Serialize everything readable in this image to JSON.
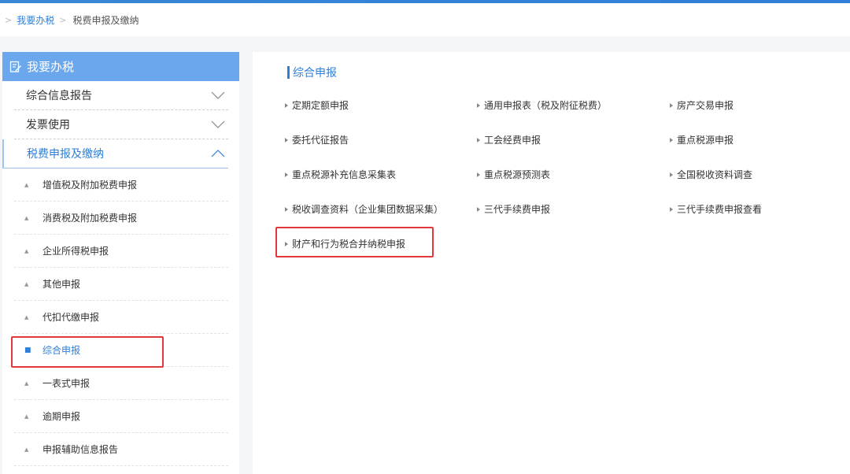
{
  "breadcrumb": {
    "root": "我要办税",
    "current": "税费申报及缴纳"
  },
  "sidebar": {
    "title": "我要办税",
    "menus": [
      {
        "label": "综合信息报告",
        "state": "collapsed"
      },
      {
        "label": "发票使用",
        "state": "collapsed"
      },
      {
        "label": "税费申报及缴纳",
        "state": "expanded"
      }
    ],
    "subitems": [
      {
        "label": "增值税及附加税费申报"
      },
      {
        "label": "消费税及附加税费申报"
      },
      {
        "label": "企业所得税申报"
      },
      {
        "label": "其他申报"
      },
      {
        "label": "代扣代缴申报"
      },
      {
        "label": "综合申报",
        "selected": true
      },
      {
        "label": "一表式申报"
      },
      {
        "label": "逾期申报"
      },
      {
        "label": "申报辅助信息报告"
      }
    ]
  },
  "main": {
    "section_title": "综合申报",
    "links": [
      "定期定额申报",
      "通用申报表（税及附征税费）",
      "房产交易申报",
      "委托代征报告",
      "工会经费申报",
      "重点税源申报",
      "重点税源补充信息采集表",
      "重点税源预测表",
      "全国税收资料调查",
      "税收调查资料（企业集团数据采集）",
      "三代手续费申报",
      "三代手续费申报查看",
      "财产和行为税合并纳税申报"
    ]
  },
  "colors": {
    "accent": "#2f7fd8",
    "sidebar_header": "#6aa7ec",
    "highlight_box": "#e0383b"
  },
  "icons": {
    "sidebar_header": "edit-document-icon",
    "collapsed": "chevron-down-icon",
    "expanded": "chevron-up-icon"
  }
}
